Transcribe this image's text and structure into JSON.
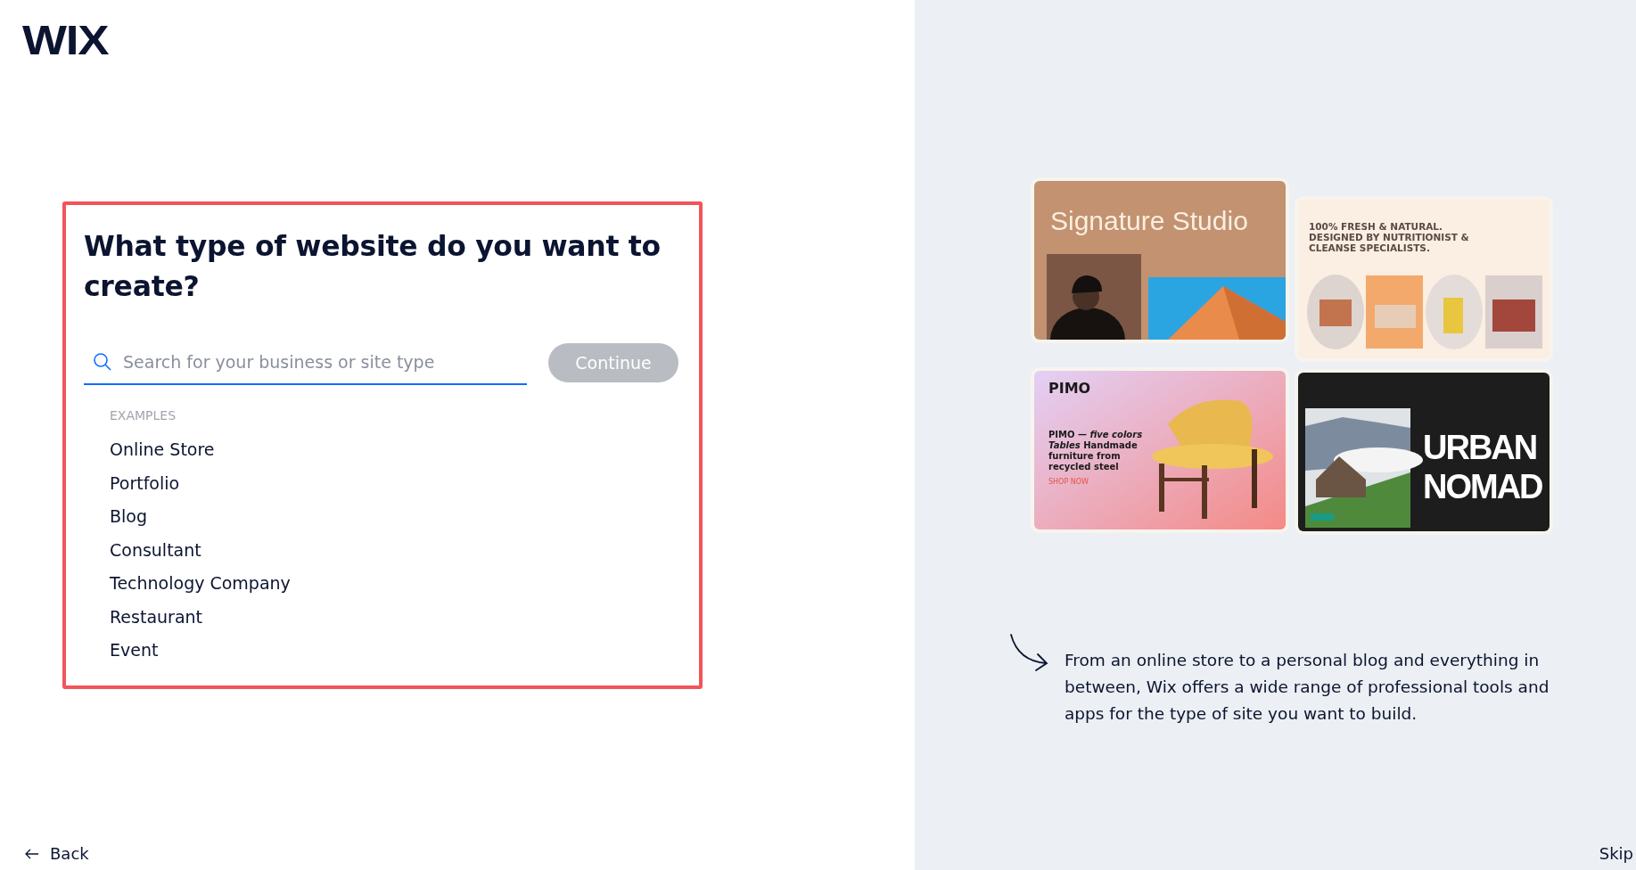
{
  "logo": "WIX",
  "heading": "What type of website do you want to create?",
  "search": {
    "placeholder": "Search for your business or site type"
  },
  "continue_button": {
    "label": "Continue",
    "disabled": true
  },
  "examples": {
    "title": "EXAMPLES",
    "items": [
      "Online Store",
      "Portfolio",
      "Blog",
      "Consultant",
      "Technology Company",
      "Restaurant",
      "Event"
    ]
  },
  "previews": [
    {
      "kind": "studio",
      "title": "Signature Studio"
    },
    {
      "kind": "juice",
      "title": "100% FRESH & NATURAL. DESIGNED BY NUTRITIONIST & CLEANSE SPECIALISTS."
    },
    {
      "kind": "furniture",
      "brand": "PIMO",
      "title": "PIMO — *five colors Tables* Handmade furniture from recycled steel",
      "cta": "SHOP NOW"
    },
    {
      "kind": "nomad",
      "title": "URBAN NOMAD"
    }
  ],
  "description": "From an online store to a personal blog and everything in between, Wix offers a wide range of professional tools and apps for the type of site you want to build.",
  "back": {
    "label": "Back"
  },
  "skip": {
    "label": "Skip"
  }
}
